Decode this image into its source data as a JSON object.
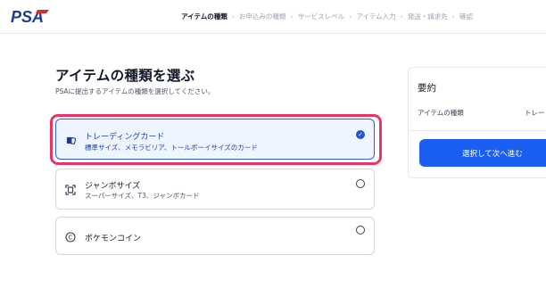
{
  "header": {
    "logo_text": "PSA",
    "steps": [
      {
        "label": "アイテムの種類",
        "active": true
      },
      {
        "label": "お申込みの種類",
        "active": false
      },
      {
        "label": "サービスレベル",
        "active": false
      },
      {
        "label": "アイテム入力",
        "active": false
      },
      {
        "label": "発送・請求先",
        "active": false
      },
      {
        "label": "確認",
        "active": false
      }
    ],
    "step_separator": "›"
  },
  "main": {
    "title": "アイテムの種類を選ぶ",
    "subtitle": "PSAに提出するアイテムの種類を選択してください。",
    "options": [
      {
        "title": "トレーディングカード",
        "description": "標準サイズ、メモラビリア、トールボーイサイズのカード",
        "icon": "card-icon",
        "selected": true
      },
      {
        "title": "ジャンボサイズ",
        "description": "スーパーサイズ、T3、ジャンボカード",
        "icon": "expand-icon",
        "selected": false
      },
      {
        "title": "ポケモンコイン",
        "description": "",
        "icon": "coin-icon",
        "selected": false
      }
    ]
  },
  "summary": {
    "title": "要約",
    "item_type_label": "アイテムの種類",
    "item_type_value": "トレー",
    "next_button_label": "選択して次へ進む"
  },
  "colors": {
    "accent": "#1a5ff1",
    "selected_bg": "#eef5ff",
    "highlight": "#e8336b",
    "logo_blue": "#1f3b8f",
    "logo_red": "#d32f2f"
  }
}
